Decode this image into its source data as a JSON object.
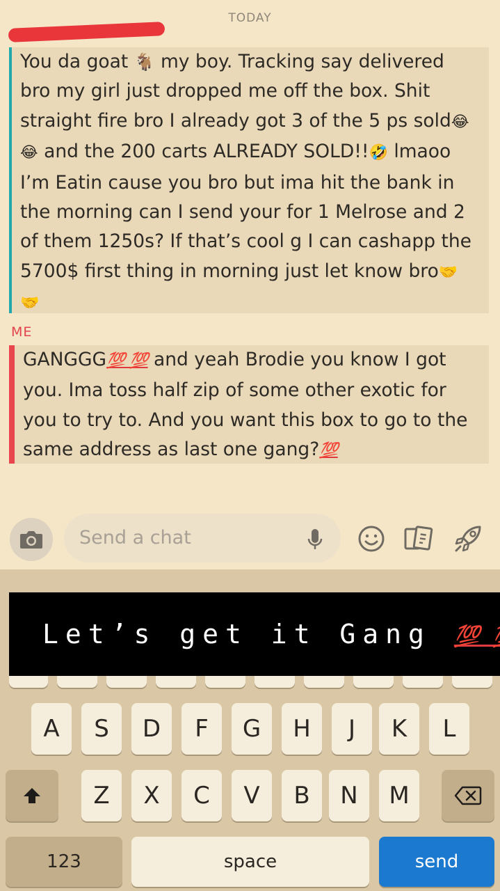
{
  "header": {
    "date_label": "TODAY"
  },
  "messages": [
    {
      "sender": "",
      "text_part1": "You da goat ",
      "emoji1": "🐐",
      "text_part2": " my boy. Tracking say delivered bro my girl just dropped me off the box. Shit straight fire bro I already got 3 of the 5 ps sold",
      "emoji2": "😂 😂",
      "text_part3": " and the 200 carts ALREADY SOLD!!",
      "emoji3": "🤣",
      "text_part4": " lmaoo I’m Eatin cause you bro but ima hit the bank in the morning can I send your for 1 Melrose and 2 of them 1250s? If that’s cool g I can cashapp the 5700$ first thing in morning just let know bro",
      "emoji4": "🤝 🤝"
    },
    {
      "sender": "ME",
      "text_part1": "GANGGG",
      "emoji1": "💯 💯",
      "text_part2": " and yeah Brodie you know I got you. Ima toss half zip of some other exotic for you to try to. And you want this box to go to the same address as last one gang?",
      "emoji2": "💯"
    }
  ],
  "composer": {
    "placeholder": "Send a chat",
    "camera_icon": "camera-icon",
    "mic_icon": "microphone-icon",
    "emoji_icon": "smiley-icon",
    "stickers_icon": "sticker-cards-icon",
    "rocket_icon": "rocket-icon"
  },
  "overlay": {
    "text": "Let’s get it Gang ",
    "emoji": "💯 💯"
  },
  "keyboard": {
    "row2": [
      "A",
      "S",
      "D",
      "F",
      "G",
      "H",
      "J",
      "K",
      "L"
    ],
    "row3": [
      "Z",
      "X",
      "C",
      "V",
      "B",
      "N",
      "M"
    ],
    "numbers_label": "123",
    "space_label": "space",
    "send_label": "send"
  },
  "colors": {
    "background": "#f5e6c8",
    "incoming_bar": "#21a8ac",
    "outgoing_bar": "#e8454f",
    "send_key": "#1b7ad0"
  }
}
